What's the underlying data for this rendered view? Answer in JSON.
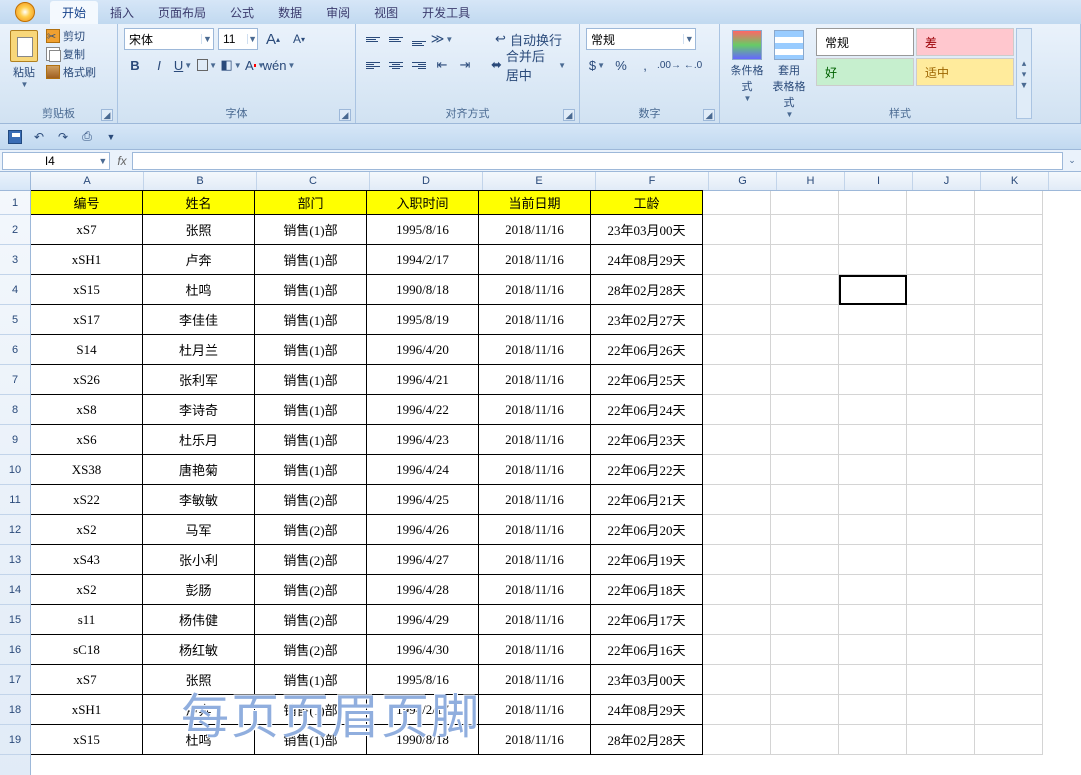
{
  "tabs": {
    "t0": "开始",
    "t1": "插入",
    "t2": "页面布局",
    "t3": "公式",
    "t4": "数据",
    "t5": "审阅",
    "t6": "视图",
    "t7": "开发工具"
  },
  "clip": {
    "paste": "粘贴",
    "cut": "剪切",
    "copy": "复制",
    "brush": "格式刷",
    "label": "剪贴板"
  },
  "font": {
    "name": "宋体",
    "size": "11",
    "label": "字体",
    "bold": "B",
    "italic": "I",
    "underline": "U"
  },
  "align": {
    "wrap": "自动换行",
    "merge": "合并后居中",
    "label": "对齐方式"
  },
  "number": {
    "format": "常规",
    "label": "数字"
  },
  "styles": {
    "cond": "条件格式",
    "table": "套用\n表格格式",
    "normal": "常规",
    "bad": "差",
    "good": "好",
    "neutral": "适中",
    "label": "样式"
  },
  "namebox": "I4",
  "formula": "",
  "cols": [
    "A",
    "B",
    "C",
    "D",
    "E",
    "F",
    "G",
    "H",
    "I",
    "J",
    "K"
  ],
  "headers": [
    "编号",
    "姓名",
    "部门",
    "入职时间",
    "当前日期",
    "工龄"
  ],
  "rows": [
    {
      "n": "2",
      "a": "xS7",
      "b": "张照",
      "c": "销售(1)部",
      "d": "1995/8/16",
      "e": "2018/11/16",
      "f": "23年03月00天"
    },
    {
      "n": "3",
      "a": "xSH1",
      "b": "卢奔",
      "c": "销售(1)部",
      "d": "1994/2/17",
      "e": "2018/11/16",
      "f": "24年08月29天"
    },
    {
      "n": "4",
      "a": "xS15",
      "b": "杜鸣",
      "c": "销售(1)部",
      "d": "1990/8/18",
      "e": "2018/11/16",
      "f": "28年02月28天"
    },
    {
      "n": "5",
      "a": "xS17",
      "b": "李佳佳",
      "c": "销售(1)部",
      "d": "1995/8/19",
      "e": "2018/11/16",
      "f": "23年02月27天"
    },
    {
      "n": "6",
      "a": "S14",
      "b": "杜月兰",
      "c": "销售(1)部",
      "d": "1996/4/20",
      "e": "2018/11/16",
      "f": "22年06月26天"
    },
    {
      "n": "7",
      "a": "xS26",
      "b": "张利军",
      "c": "销售(1)部",
      "d": "1996/4/21",
      "e": "2018/11/16",
      "f": "22年06月25天"
    },
    {
      "n": "8",
      "a": "xS8",
      "b": "李诗奇",
      "c": "销售(1)部",
      "d": "1996/4/22",
      "e": "2018/11/16",
      "f": "22年06月24天"
    },
    {
      "n": "9",
      "a": "xS6",
      "b": "杜乐月",
      "c": "销售(1)部",
      "d": "1996/4/23",
      "e": "2018/11/16",
      "f": "22年06月23天"
    },
    {
      "n": "10",
      "a": "XS38",
      "b": "唐艳菊",
      "c": "销售(1)部",
      "d": "1996/4/24",
      "e": "2018/11/16",
      "f": "22年06月22天"
    },
    {
      "n": "11",
      "a": "xS22",
      "b": "李敏敏",
      "c": "销售(2)部",
      "d": "1996/4/25",
      "e": "2018/11/16",
      "f": "22年06月21天"
    },
    {
      "n": "12",
      "a": "xS2",
      "b": "马军",
      "c": "销售(2)部",
      "d": "1996/4/26",
      "e": "2018/11/16",
      "f": "22年06月20天"
    },
    {
      "n": "13",
      "a": "xS43",
      "b": "张小利",
      "c": "销售(2)部",
      "d": "1996/4/27",
      "e": "2018/11/16",
      "f": "22年06月19天"
    },
    {
      "n": "14",
      "a": "xS2",
      "b": "彭肠",
      "c": "销售(2)部",
      "d": "1996/4/28",
      "e": "2018/11/16",
      "f": "22年06月18天"
    },
    {
      "n": "15",
      "a": "s11",
      "b": "杨伟健",
      "c": "销售(2)部",
      "d": "1996/4/29",
      "e": "2018/11/16",
      "f": "22年06月17天"
    },
    {
      "n": "16",
      "a": "sC18",
      "b": "杨红敏",
      "c": "销售(2)部",
      "d": "1996/4/30",
      "e": "2018/11/16",
      "f": "22年06月16天"
    },
    {
      "n": "17",
      "a": "xS7",
      "b": "张照",
      "c": "销售(1)部",
      "d": "1995/8/16",
      "e": "2018/11/16",
      "f": "23年03月00天"
    },
    {
      "n": "18",
      "a": "xSH1",
      "b": "卢奔",
      "c": "销售(1)部",
      "d": "1994/2/17",
      "e": "2018/11/16",
      "f": "24年08月29天"
    },
    {
      "n": "19",
      "a": "xS15",
      "b": "杜鸣",
      "c": "销售(1)部",
      "d": "1990/8/18",
      "e": "2018/11/16",
      "f": "28年02月28天"
    }
  ],
  "watermark": "每页页眉页脚"
}
